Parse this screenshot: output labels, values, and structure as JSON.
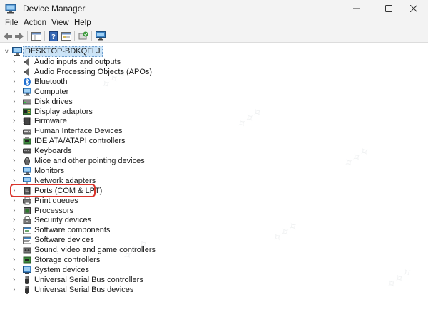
{
  "window": {
    "title": "Device Manager",
    "minimize_icon": "minimize-icon",
    "maximize_icon": "maximize-icon",
    "close_icon": "close-icon"
  },
  "menu": [
    "File",
    "Action",
    "View",
    "Help"
  ],
  "toolbar": [
    "back-icon",
    "forward-icon",
    "show-hide-icon",
    "help-icon",
    "properties-icon",
    "update-driver-icon",
    "scan-hardware-icon"
  ],
  "tree": {
    "root": "DESKTOP-BDKQFLJ",
    "items": [
      {
        "label": "Audio inputs and outputs",
        "icon": "speaker-icon"
      },
      {
        "label": "Audio Processing Objects (APOs)",
        "icon": "speaker-icon"
      },
      {
        "label": "Bluetooth",
        "icon": "bluetooth-icon"
      },
      {
        "label": "Computer",
        "icon": "computer-icon"
      },
      {
        "label": "Disk drives",
        "icon": "disk-drive-icon"
      },
      {
        "label": "Display adaptors",
        "icon": "display-adapter-icon"
      },
      {
        "label": "Firmware",
        "icon": "firmware-icon"
      },
      {
        "label": "Human Interface Devices",
        "icon": "hid-icon"
      },
      {
        "label": "IDE ATA/ATAPI controllers",
        "icon": "ide-controller-icon"
      },
      {
        "label": "Keyboards",
        "icon": "keyboard-icon"
      },
      {
        "label": "Mice and other pointing devices",
        "icon": "mouse-icon"
      },
      {
        "label": "Monitors",
        "icon": "monitor-icon"
      },
      {
        "label": "Network adapters",
        "icon": "network-adapter-icon"
      },
      {
        "label": "Ports (COM & LPT)",
        "icon": "port-icon"
      },
      {
        "label": "Print queues",
        "icon": "printer-icon"
      },
      {
        "label": "Processors",
        "icon": "processor-icon"
      },
      {
        "label": "Security devices",
        "icon": "security-device-icon"
      },
      {
        "label": "Software components",
        "icon": "software-component-icon"
      },
      {
        "label": "Software devices",
        "icon": "software-device-icon"
      },
      {
        "label": "Sound, video and game controllers",
        "icon": "sound-controller-icon"
      },
      {
        "label": "Storage controllers",
        "icon": "storage-controller-icon"
      },
      {
        "label": "System devices",
        "icon": "system-device-icon"
      },
      {
        "label": "Universal Serial Bus controllers",
        "icon": "usb-icon"
      },
      {
        "label": "Universal Serial Bus devices",
        "icon": "usb-icon"
      }
    ]
  },
  "colors": {
    "highlight": "#d9342b",
    "selection": "#cce4f7",
    "chrome": "#f3f3f3"
  }
}
